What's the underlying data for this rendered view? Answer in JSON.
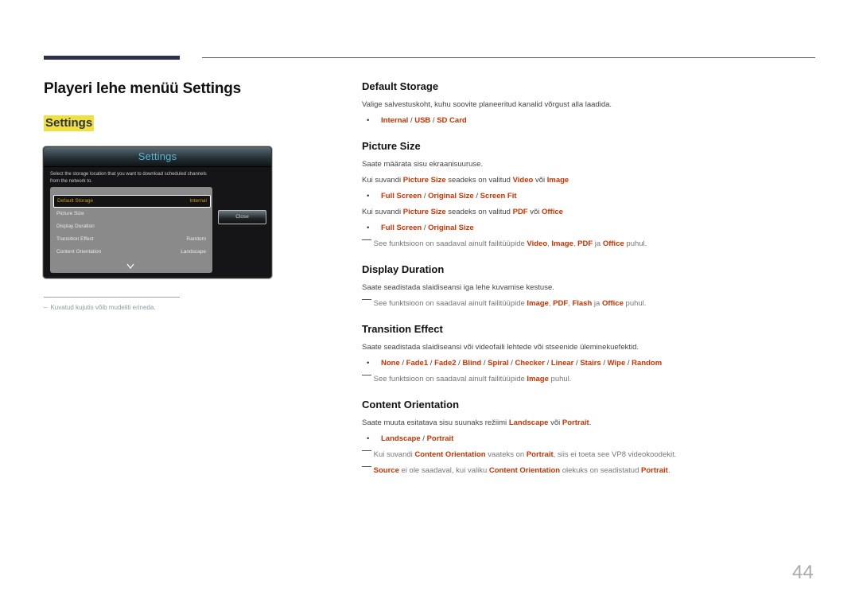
{
  "page": {
    "title": "Playeri lehe menüü Settings",
    "section_tag": "Settings",
    "page_number": "44",
    "footnote": "Kuvatud kujutis võib mudeliti erineda.",
    "footnote_dash": "–"
  },
  "dialog": {
    "title": "Settings",
    "description": "Select the storage location that you want to download scheduled channels from the network to.",
    "items": [
      {
        "label": "Default Storage",
        "value": "Internal",
        "selected": true
      },
      {
        "label": "Picture Size",
        "value": ""
      },
      {
        "label": "Display Duration",
        "value": ""
      },
      {
        "label": "Transition Effect",
        "value": "Random"
      },
      {
        "label": "Content Orientation",
        "value": "Landscape"
      }
    ],
    "close_label": "Close",
    "scroll_icon": "chevron-down-icon"
  },
  "accent_color": "#cc3300",
  "sections": {
    "default_storage": {
      "heading": "Default Storage",
      "text": "Valige salvestuskoht, kuhu soovite planeeritud kanalid võrgust alla laadida.",
      "options": [
        "Internal",
        "USB",
        "SD Card"
      ]
    },
    "picture_size": {
      "heading": "Picture Size",
      "text": "Saate määrata sisu ekraanisuuruse.",
      "cond1": {
        "pre": "Kui suvandi",
        "k1": "Picture Size",
        "mid": "seadeks on valitud",
        "k2": "Video",
        "or": "või",
        "k3": "Image"
      },
      "options1": [
        "Full Screen",
        "Original Size",
        "Screen Fit"
      ],
      "cond2": {
        "pre": "Kui suvandi",
        "k1": "Picture Size",
        "mid": "seadeks on valitud",
        "k2": "PDF",
        "or": "või",
        "k3": "Office"
      },
      "options2": [
        "Full Screen",
        "Original Size"
      ],
      "note": {
        "pre": "See funktsioon on saadaval ainult failitüüpide",
        "k1": "Video",
        "k2": "Image",
        "k3": "PDF",
        "ja": "ja",
        "k4": "Office",
        "post": "puhul."
      }
    },
    "display_duration": {
      "heading": "Display Duration",
      "text": "Saate seadistada slaidiseansi iga lehe kuvamise kestuse.",
      "note": {
        "pre": "See funktsioon on saadaval ainult failitüüpide",
        "k1": "Image",
        "k2": "PDF",
        "k3": "Flash",
        "ja": "ja",
        "k4": "Office",
        "post": "puhul."
      }
    },
    "transition_effect": {
      "heading": "Transition Effect",
      "text": "Saate seadistada slaidiseansi või videofaili lehtede või stseenide üleminekuefektid.",
      "options": [
        "None",
        "Fade1",
        "Fade2",
        "Blind",
        "Spiral",
        "Checker",
        "Linear",
        "Stairs",
        "Wipe",
        "Random"
      ],
      "note": {
        "pre": "See funktsioon on saadaval ainult failitüüpide",
        "k1": "Image",
        "post": "puhul."
      }
    },
    "content_orientation": {
      "heading": "Content Orientation",
      "text": {
        "pre": "Saate muuta esitatava sisu suunaks režiimi",
        "k1": "Landscape",
        "or": "või",
        "k2": "Portrait",
        "post": "."
      },
      "options": [
        "Landscape",
        "Portrait"
      ],
      "note1": {
        "pre": "Kui suvandi",
        "k1": "Content Orientation",
        "mid": "vaateks on",
        "k2": "Portrait",
        "post": ", siis ei toeta see VP8 videokoodekit."
      },
      "note2": {
        "k1": "Source",
        "mid": "ei ole saadaval, kui valiku",
        "k2": "Content Orientation",
        "mid2": "olekuks on seadistatud",
        "k3": "Portrait",
        "post": "."
      }
    }
  }
}
